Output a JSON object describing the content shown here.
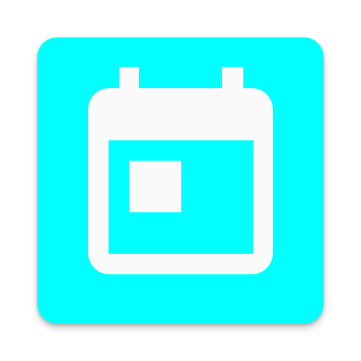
{
  "app_icon": {
    "icon": "calendar-today-icon",
    "tile_color": "#00ffff",
    "glyph_color": "#fafafa"
  }
}
